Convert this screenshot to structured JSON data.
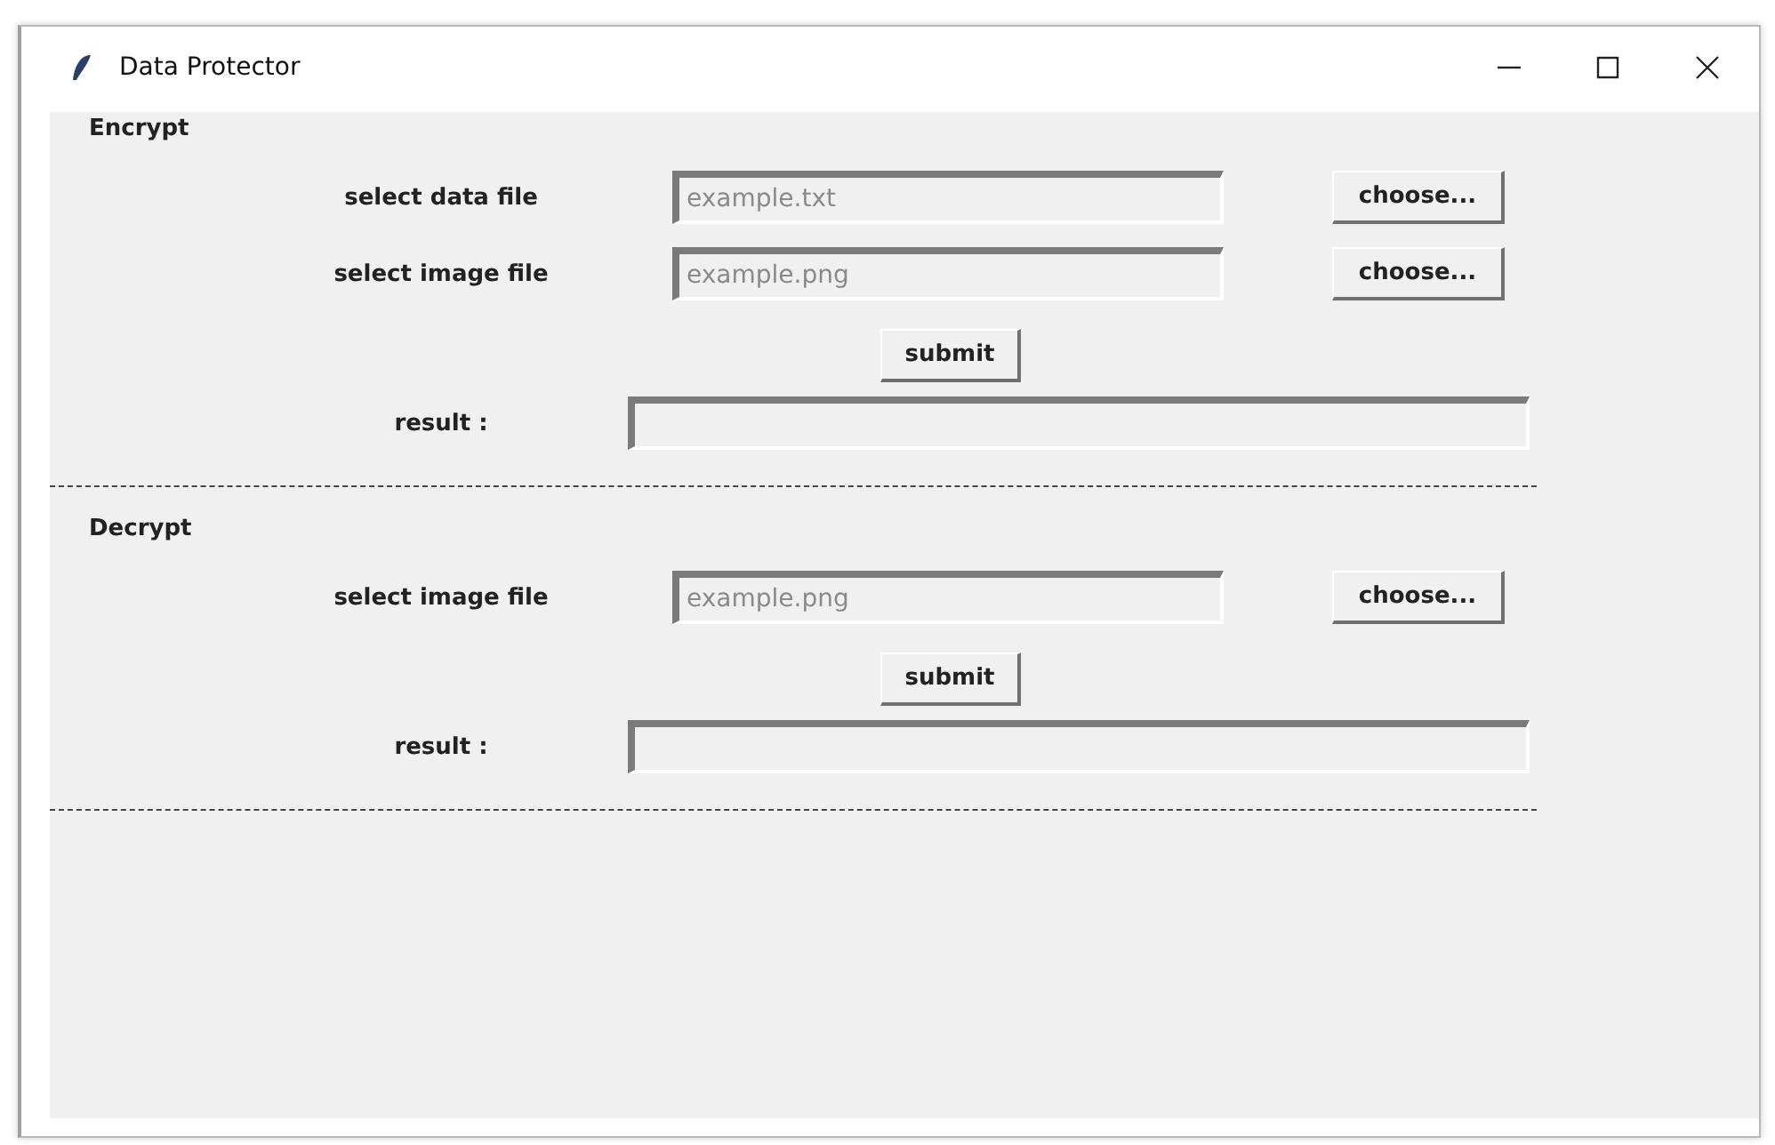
{
  "window": {
    "title": "Data Protector"
  },
  "sections": [
    {
      "title": "Encrypt",
      "file_rows": [
        {
          "label": "select data file",
          "placeholder": "example.txt",
          "button": "choose..."
        },
        {
          "label": "select image file",
          "placeholder": "example.png",
          "button": "choose..."
        }
      ],
      "submit": "submit",
      "result_label": "result :"
    },
    {
      "title": "Decrypt",
      "file_rows": [
        {
          "label": "select image file",
          "placeholder": "example.png",
          "button": "choose..."
        }
      ],
      "submit": "submit",
      "result_label": "result :"
    }
  ]
}
